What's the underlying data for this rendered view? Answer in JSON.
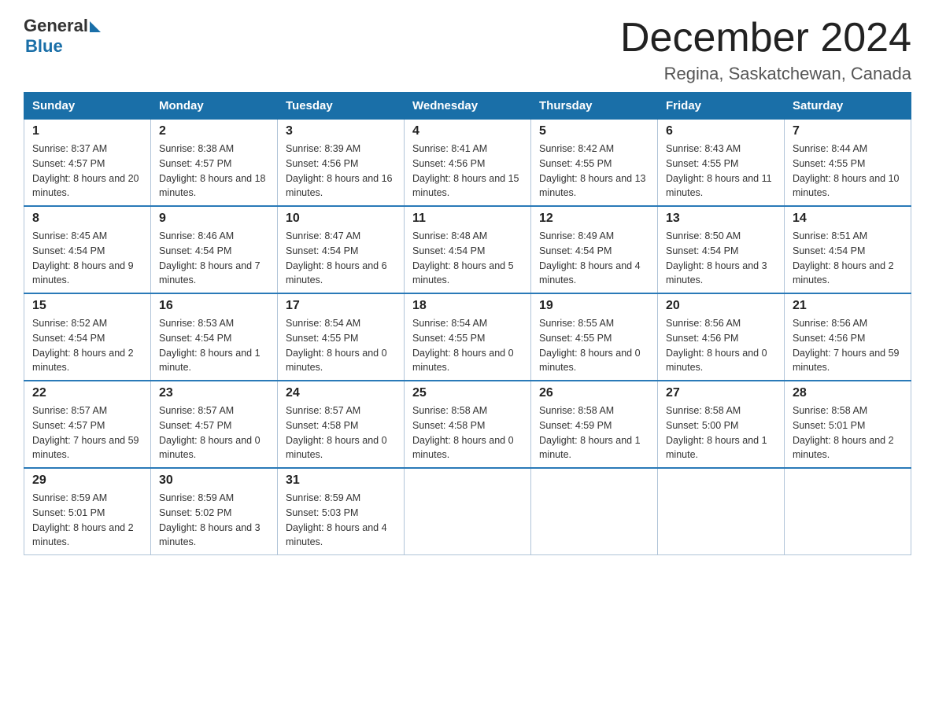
{
  "logo": {
    "general": "General",
    "blue": "Blue"
  },
  "header": {
    "month": "December 2024",
    "location": "Regina, Saskatchewan, Canada"
  },
  "days_of_week": [
    "Sunday",
    "Monday",
    "Tuesday",
    "Wednesday",
    "Thursday",
    "Friday",
    "Saturday"
  ],
  "weeks": [
    [
      {
        "day": "1",
        "sunrise": "8:37 AM",
        "sunset": "4:57 PM",
        "daylight": "8 hours and 20 minutes."
      },
      {
        "day": "2",
        "sunrise": "8:38 AM",
        "sunset": "4:57 PM",
        "daylight": "8 hours and 18 minutes."
      },
      {
        "day": "3",
        "sunrise": "8:39 AM",
        "sunset": "4:56 PM",
        "daylight": "8 hours and 16 minutes."
      },
      {
        "day": "4",
        "sunrise": "8:41 AM",
        "sunset": "4:56 PM",
        "daylight": "8 hours and 15 minutes."
      },
      {
        "day": "5",
        "sunrise": "8:42 AM",
        "sunset": "4:55 PM",
        "daylight": "8 hours and 13 minutes."
      },
      {
        "day": "6",
        "sunrise": "8:43 AM",
        "sunset": "4:55 PM",
        "daylight": "8 hours and 11 minutes."
      },
      {
        "day": "7",
        "sunrise": "8:44 AM",
        "sunset": "4:55 PM",
        "daylight": "8 hours and 10 minutes."
      }
    ],
    [
      {
        "day": "8",
        "sunrise": "8:45 AM",
        "sunset": "4:54 PM",
        "daylight": "8 hours and 9 minutes."
      },
      {
        "day": "9",
        "sunrise": "8:46 AM",
        "sunset": "4:54 PM",
        "daylight": "8 hours and 7 minutes."
      },
      {
        "day": "10",
        "sunrise": "8:47 AM",
        "sunset": "4:54 PM",
        "daylight": "8 hours and 6 minutes."
      },
      {
        "day": "11",
        "sunrise": "8:48 AM",
        "sunset": "4:54 PM",
        "daylight": "8 hours and 5 minutes."
      },
      {
        "day": "12",
        "sunrise": "8:49 AM",
        "sunset": "4:54 PM",
        "daylight": "8 hours and 4 minutes."
      },
      {
        "day": "13",
        "sunrise": "8:50 AM",
        "sunset": "4:54 PM",
        "daylight": "8 hours and 3 minutes."
      },
      {
        "day": "14",
        "sunrise": "8:51 AM",
        "sunset": "4:54 PM",
        "daylight": "8 hours and 2 minutes."
      }
    ],
    [
      {
        "day": "15",
        "sunrise": "8:52 AM",
        "sunset": "4:54 PM",
        "daylight": "8 hours and 2 minutes."
      },
      {
        "day": "16",
        "sunrise": "8:53 AM",
        "sunset": "4:54 PM",
        "daylight": "8 hours and 1 minute."
      },
      {
        "day": "17",
        "sunrise": "8:54 AM",
        "sunset": "4:55 PM",
        "daylight": "8 hours and 0 minutes."
      },
      {
        "day": "18",
        "sunrise": "8:54 AM",
        "sunset": "4:55 PM",
        "daylight": "8 hours and 0 minutes."
      },
      {
        "day": "19",
        "sunrise": "8:55 AM",
        "sunset": "4:55 PM",
        "daylight": "8 hours and 0 minutes."
      },
      {
        "day": "20",
        "sunrise": "8:56 AM",
        "sunset": "4:56 PM",
        "daylight": "8 hours and 0 minutes."
      },
      {
        "day": "21",
        "sunrise": "8:56 AM",
        "sunset": "4:56 PM",
        "daylight": "7 hours and 59 minutes."
      }
    ],
    [
      {
        "day": "22",
        "sunrise": "8:57 AM",
        "sunset": "4:57 PM",
        "daylight": "7 hours and 59 minutes."
      },
      {
        "day": "23",
        "sunrise": "8:57 AM",
        "sunset": "4:57 PM",
        "daylight": "8 hours and 0 minutes."
      },
      {
        "day": "24",
        "sunrise": "8:57 AM",
        "sunset": "4:58 PM",
        "daylight": "8 hours and 0 minutes."
      },
      {
        "day": "25",
        "sunrise": "8:58 AM",
        "sunset": "4:58 PM",
        "daylight": "8 hours and 0 minutes."
      },
      {
        "day": "26",
        "sunrise": "8:58 AM",
        "sunset": "4:59 PM",
        "daylight": "8 hours and 1 minute."
      },
      {
        "day": "27",
        "sunrise": "8:58 AM",
        "sunset": "5:00 PM",
        "daylight": "8 hours and 1 minute."
      },
      {
        "day": "28",
        "sunrise": "8:58 AM",
        "sunset": "5:01 PM",
        "daylight": "8 hours and 2 minutes."
      }
    ],
    [
      {
        "day": "29",
        "sunrise": "8:59 AM",
        "sunset": "5:01 PM",
        "daylight": "8 hours and 2 minutes."
      },
      {
        "day": "30",
        "sunrise": "8:59 AM",
        "sunset": "5:02 PM",
        "daylight": "8 hours and 3 minutes."
      },
      {
        "day": "31",
        "sunrise": "8:59 AM",
        "sunset": "5:03 PM",
        "daylight": "8 hours and 4 minutes."
      },
      null,
      null,
      null,
      null
    ]
  ]
}
